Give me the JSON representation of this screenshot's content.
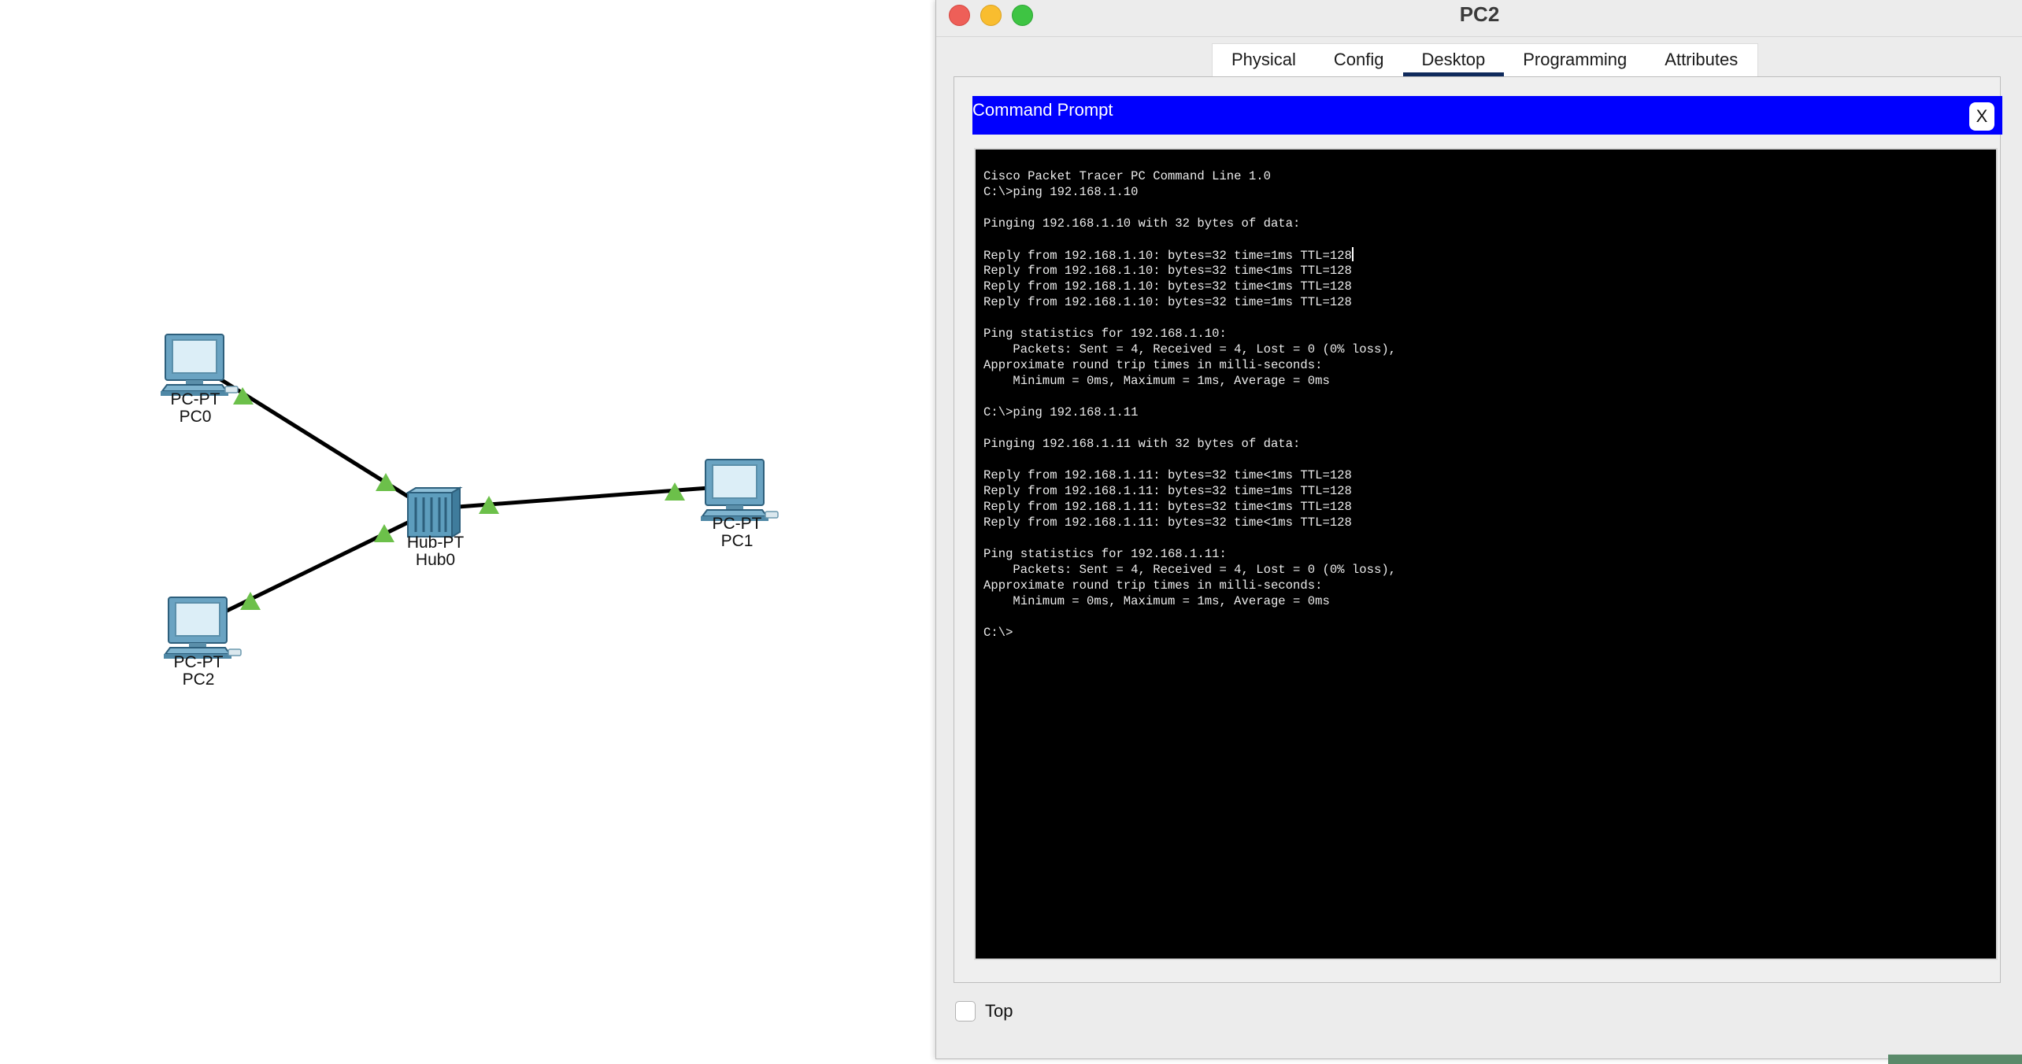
{
  "workspace": {
    "devices": [
      {
        "model": "PC-PT",
        "name": "PC0",
        "icon": "pc-icon"
      },
      {
        "model": "Hub-PT",
        "name": "Hub0",
        "icon": "hub-icon"
      },
      {
        "model": "PC-PT",
        "name": "PC1",
        "icon": "pc-icon"
      },
      {
        "model": "PC-PT",
        "name": "PC2",
        "icon": "pc-icon"
      }
    ],
    "links": [
      {
        "from": "PC0",
        "to": "Hub0",
        "status": "up"
      },
      {
        "from": "PC2",
        "to": "Hub0",
        "status": "up"
      },
      {
        "from": "Hub0",
        "to": "PC1",
        "status": "up"
      }
    ],
    "link_up_color": "#6cc04a",
    "cable_color": "#000000"
  },
  "window": {
    "title": "PC2",
    "tabs": [
      "Physical",
      "Config",
      "Desktop",
      "Programming",
      "Attributes"
    ],
    "active_tab": "Desktop",
    "command_prompt": {
      "title": "Command Prompt",
      "close_label": "X",
      "header_color": "#0000ff",
      "lines": [
        "Cisco Packet Tracer PC Command Line 1.0",
        "C:\\>ping 192.168.1.10",
        "",
        "Pinging 192.168.1.10 with 32 bytes of data:",
        "",
        "Reply from 192.168.1.10: bytes=32 time=1ms TTL=128",
        "Reply from 192.168.1.10: bytes=32 time<1ms TTL=128",
        "Reply from 192.168.1.10: bytes=32 time<1ms TTL=128",
        "Reply from 192.168.1.10: bytes=32 time=1ms TTL=128",
        "",
        "Ping statistics for 192.168.1.10:",
        "    Packets: Sent = 4, Received = 4, Lost = 0 (0% loss),",
        "Approximate round trip times in milli-seconds:",
        "    Minimum = 0ms, Maximum = 1ms, Average = 0ms",
        "",
        "C:\\>ping 192.168.1.11",
        "",
        "Pinging 192.168.1.11 with 32 bytes of data:",
        "",
        "Reply from 192.168.1.11: bytes=32 time<1ms TTL=128",
        "Reply from 192.168.1.11: bytes=32 time=1ms TTL=128",
        "Reply from 192.168.1.11: bytes=32 time<1ms TTL=128",
        "Reply from 192.168.1.11: bytes=32 time<1ms TTL=128",
        "",
        "Ping statistics for 192.168.1.11:",
        "    Packets: Sent = 4, Received = 4, Lost = 0 (0% loss),",
        "Approximate round trip times in milli-seconds:",
        "    Minimum = 0ms, Maximum = 1ms, Average = 0ms",
        "",
        "C:\\>"
      ]
    },
    "top_checkbox": {
      "label": "Top",
      "checked": false
    }
  }
}
